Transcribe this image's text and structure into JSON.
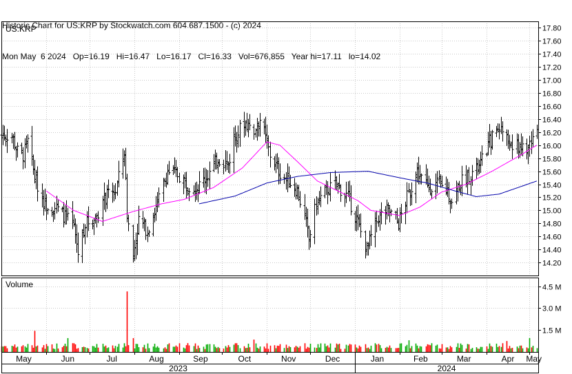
{
  "header": {
    "line1": "Historic Chart for US:KRP by Stockwatch.com 604.687.1500 - (c) 2024",
    "line2": "Mon May  6 2024   Op=16.19   Hi=16.47   Lo=16.17   Cl=16.33   Vol=676,855   Year hi=17.11   lo=14.02"
  },
  "colors": {
    "price_bar": "#000000",
    "ma_short": "#ff00ff",
    "ma_long": "#0000aa",
    "vol_up": "#00aa00",
    "vol_down": "#ff0000",
    "grid": "#c8c8c8"
  },
  "chart_data": [
    {
      "type": "ohlc",
      "symbol_label": "US:KRP",
      "ylim": [
        14.0,
        17.9
      ],
      "yticks": [
        "17.80",
        "17.60",
        "17.40",
        "17.20",
        "17.00",
        "16.80",
        "16.60",
        "16.40",
        "16.20",
        "16.00",
        "15.80",
        "15.60",
        "15.40",
        "15.20",
        "15.00",
        "14.80",
        "14.60",
        "14.40",
        "14.20"
      ],
      "grid": true,
      "price_keyframes": [
        [
          "2023-05-08",
          16.15
        ],
        [
          "2023-05-12",
          15.9
        ],
        [
          "2023-05-16",
          15.85
        ],
        [
          "2023-05-19",
          16.05
        ],
        [
          "2023-05-24",
          15.5
        ],
        [
          "2023-05-31",
          15.1
        ],
        [
          "2023-06-07",
          15.05
        ],
        [
          "2023-06-14",
          14.9
        ],
        [
          "2023-06-20",
          14.75
        ],
        [
          "2023-06-23",
          14.35
        ],
        [
          "2023-06-28",
          14.8
        ],
        [
          "2023-07-05",
          14.9
        ],
        [
          "2023-07-12",
          15.2
        ],
        [
          "2023-07-19",
          15.3
        ],
        [
          "2023-07-25",
          15.9
        ],
        [
          "2023-07-27",
          14.95
        ],
        [
          "2023-07-31",
          14.3
        ],
        [
          "2023-08-04",
          14.85
        ],
        [
          "2023-08-10",
          14.7
        ],
        [
          "2023-08-17",
          15.1
        ],
        [
          "2023-08-24",
          15.6
        ],
        [
          "2023-08-31",
          15.55
        ],
        [
          "2023-09-07",
          15.4
        ],
        [
          "2023-09-14",
          15.35
        ],
        [
          "2023-09-21",
          15.55
        ],
        [
          "2023-09-28",
          15.8
        ],
        [
          "2023-10-05",
          15.7
        ],
        [
          "2023-10-09",
          16.1
        ],
        [
          "2023-10-16",
          16.35
        ],
        [
          "2023-10-23",
          16.25
        ],
        [
          "2023-10-27",
          16.4
        ],
        [
          "2023-10-31",
          16.1
        ],
        [
          "2023-11-03",
          15.85
        ],
        [
          "2023-11-09",
          15.6
        ],
        [
          "2023-11-16",
          15.45
        ],
        [
          "2023-11-22",
          15.3
        ],
        [
          "2023-11-27",
          14.9
        ],
        [
          "2023-11-30",
          14.55
        ],
        [
          "2023-12-05",
          15.1
        ],
        [
          "2023-12-12",
          15.3
        ],
        [
          "2023-12-19",
          15.4
        ],
        [
          "2023-12-27",
          15.2
        ],
        [
          "2024-01-03",
          14.8
        ],
        [
          "2024-01-09",
          14.4
        ],
        [
          "2024-01-17",
          14.9
        ],
        [
          "2024-01-24",
          15.0
        ],
        [
          "2024-01-31",
          14.8
        ],
        [
          "2024-02-06",
          15.2
        ],
        [
          "2024-02-13",
          15.6
        ],
        [
          "2024-02-20",
          15.35
        ],
        [
          "2024-02-27",
          15.4
        ],
        [
          "2024-03-05",
          15.3
        ],
        [
          "2024-03-08",
          15.15
        ],
        [
          "2024-03-13",
          15.4
        ],
        [
          "2024-03-20",
          15.55
        ],
        [
          "2024-03-27",
          15.65
        ],
        [
          "2024-04-03",
          16.05
        ],
        [
          "2024-04-10",
          16.3
        ],
        [
          "2024-04-15",
          16.1
        ],
        [
          "2024-04-19",
          15.95
        ],
        [
          "2024-04-24",
          16.0
        ],
        [
          "2024-04-29",
          15.9
        ],
        [
          "2024-05-02",
          16.1
        ],
        [
          "2024-05-06",
          16.33
        ]
      ],
      "ma_short_keyframes": [
        [
          "2023-06-01",
          15.3
        ],
        [
          "2023-06-20",
          15.0
        ],
        [
          "2023-07-10",
          14.83
        ],
        [
          "2023-07-31",
          14.98
        ],
        [
          "2023-08-20",
          15.1
        ],
        [
          "2023-09-05",
          15.17
        ],
        [
          "2023-09-25",
          15.35
        ],
        [
          "2023-10-15",
          15.65
        ],
        [
          "2023-11-01",
          16.05
        ],
        [
          "2023-11-10",
          16.0
        ],
        [
          "2023-11-22",
          15.75
        ],
        [
          "2023-12-06",
          15.45
        ],
        [
          "2023-12-20",
          15.3
        ],
        [
          "2024-01-03",
          15.15
        ],
        [
          "2024-01-12",
          15.0
        ],
        [
          "2024-02-01",
          14.92
        ],
        [
          "2024-02-15",
          15.05
        ],
        [
          "2024-03-01",
          15.28
        ],
        [
          "2024-03-18",
          15.4
        ],
        [
          "2024-04-05",
          15.6
        ],
        [
          "2024-04-25",
          15.85
        ],
        [
          "2024-05-06",
          16.0
        ]
      ],
      "ma_long_keyframes": [
        [
          "2023-09-15",
          15.1
        ],
        [
          "2023-10-10",
          15.22
        ],
        [
          "2023-11-01",
          15.42
        ],
        [
          "2023-11-22",
          15.52
        ],
        [
          "2023-12-15",
          15.58
        ],
        [
          "2024-01-10",
          15.6
        ],
        [
          "2024-02-01",
          15.5
        ],
        [
          "2024-02-20",
          15.42
        ],
        [
          "2024-03-10",
          15.3
        ],
        [
          "2024-03-25",
          15.21
        ],
        [
          "2024-04-10",
          15.25
        ],
        [
          "2024-05-06",
          15.45
        ]
      ]
    },
    {
      "type": "bar",
      "title": "Volume",
      "ylim": [
        0,
        5.1
      ],
      "unit": "M",
      "yticks": [
        "4.5 M",
        "3.0 M",
        "1.5 M"
      ],
      "ytick_values": [
        4.5,
        3.0,
        1.5
      ],
      "baseline_volume_m": 0.45,
      "spikes": [
        [
          "2023-05-24",
          1.45
        ],
        [
          "2023-06-16",
          0.95
        ],
        [
          "2023-07-27",
          4.15
        ],
        [
          "2023-07-31",
          0.95
        ],
        [
          "2023-10-23",
          0.85
        ],
        [
          "2024-02-07",
          0.8
        ],
        [
          "2024-04-15",
          0.75
        ],
        [
          "2024-05-01",
          0.95
        ]
      ]
    }
  ],
  "x_axis": {
    "months": [
      {
        "label": "May",
        "date": "2023-05-01"
      },
      {
        "label": "Jun",
        "date": "2023-06-01"
      },
      {
        "label": "Jul",
        "date": "2023-07-01"
      },
      {
        "label": "Aug",
        "date": "2023-08-01"
      },
      {
        "label": "Sep",
        "date": "2023-09-01"
      },
      {
        "label": "Oct",
        "date": "2023-10-01"
      },
      {
        "label": "Nov",
        "date": "2023-11-01"
      },
      {
        "label": "Dec",
        "date": "2023-12-01"
      },
      {
        "label": "Jan",
        "date": "2024-01-01"
      },
      {
        "label": "Feb",
        "date": "2024-02-01"
      },
      {
        "label": "Mar",
        "date": "2024-03-01"
      },
      {
        "label": "Apr",
        "date": "2024-04-01"
      },
      {
        "label": "May",
        "date": "2024-05-01"
      }
    ],
    "years": [
      {
        "label": "2023",
        "start": "2023-05-01",
        "end": "2024-01-01"
      },
      {
        "label": "2024",
        "start": "2024-01-01",
        "end": "2024-05-07"
      }
    ],
    "range": [
      "2023-05-01",
      "2024-05-07"
    ]
  }
}
